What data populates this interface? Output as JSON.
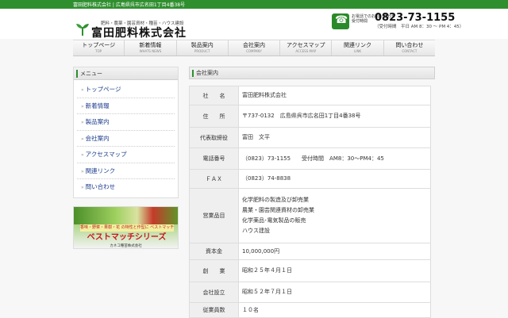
{
  "topbar": {
    "text": "富田肥料株式会社 | 広島県呉市広名田1丁目4番38号"
  },
  "logo": {
    "tagline": "肥料・農薬・園芸資材・種苗・ハウス建設",
    "name": "富田肥料株式会社"
  },
  "contact": {
    "label": "お電話でのお問い合わせ\n受付時間",
    "number": "0823-73-1155",
    "hours": "（受付時間　平日 AM 8：30 〜 PM 4：45）"
  },
  "nav": [
    {
      "label": "トップページ",
      "sub": "TOP"
    },
    {
      "label": "新着情報",
      "sub": "WHATS NEWS"
    },
    {
      "label": "製品案内",
      "sub": "PRODUCT"
    },
    {
      "label": "会社案内",
      "sub": "COMPANY"
    },
    {
      "label": "アクセスマップ",
      "sub": "ACCESS MAP"
    },
    {
      "label": "関連リンク",
      "sub": "LINK"
    },
    {
      "label": "問い合わせ",
      "sub": "CONTACT"
    }
  ],
  "sidebar": {
    "title": "メニュー",
    "items": [
      "トップページ",
      "新着情報",
      "製品案内",
      "会社案内",
      "アクセスマップ",
      "関連リンク",
      "問い合わせ"
    ]
  },
  "banner": {
    "strip": "香味・野菜・果樹・花 の特性と作型に ベストマッチ",
    "title": "ベストマッチシリーズ",
    "maker": "カネコ種苗株式会社"
  },
  "main": {
    "heading": "会社案内",
    "rows": [
      {
        "label": "社　　名",
        "values": [
          "富田肥料株式会社"
        ]
      },
      {
        "label": "住　　所",
        "values": [
          "〒737-0132　広島県呉市広名田1丁目4番38号"
        ]
      },
      {
        "label": "代表取締役",
        "values": [
          "富田　文平"
        ]
      },
      {
        "label": "電話番号",
        "values": [
          "（0823）73-1155　　受付時間　AM8：30〜PM4：45"
        ]
      },
      {
        "label": "ＦＡＸ",
        "values": [
          "（0823）74-8838"
        ]
      },
      {
        "label": "営業品目",
        "values": [
          "化学肥料の製造及び卸売業",
          "農業・園芸関連資材の卸売業",
          "化学薬品･電気製品の販売",
          "ハウス建設"
        ]
      },
      {
        "label": "資本金",
        "values": [
          "10,000,000円"
        ]
      },
      {
        "label": "創　　業",
        "values": [
          "昭和２５年４月１日"
        ]
      },
      {
        "label": "会社設立",
        "values": [
          "昭和５２年７月１日"
        ]
      },
      {
        "label": "従業員数",
        "values": [
          "１０名"
        ]
      }
    ]
  }
}
